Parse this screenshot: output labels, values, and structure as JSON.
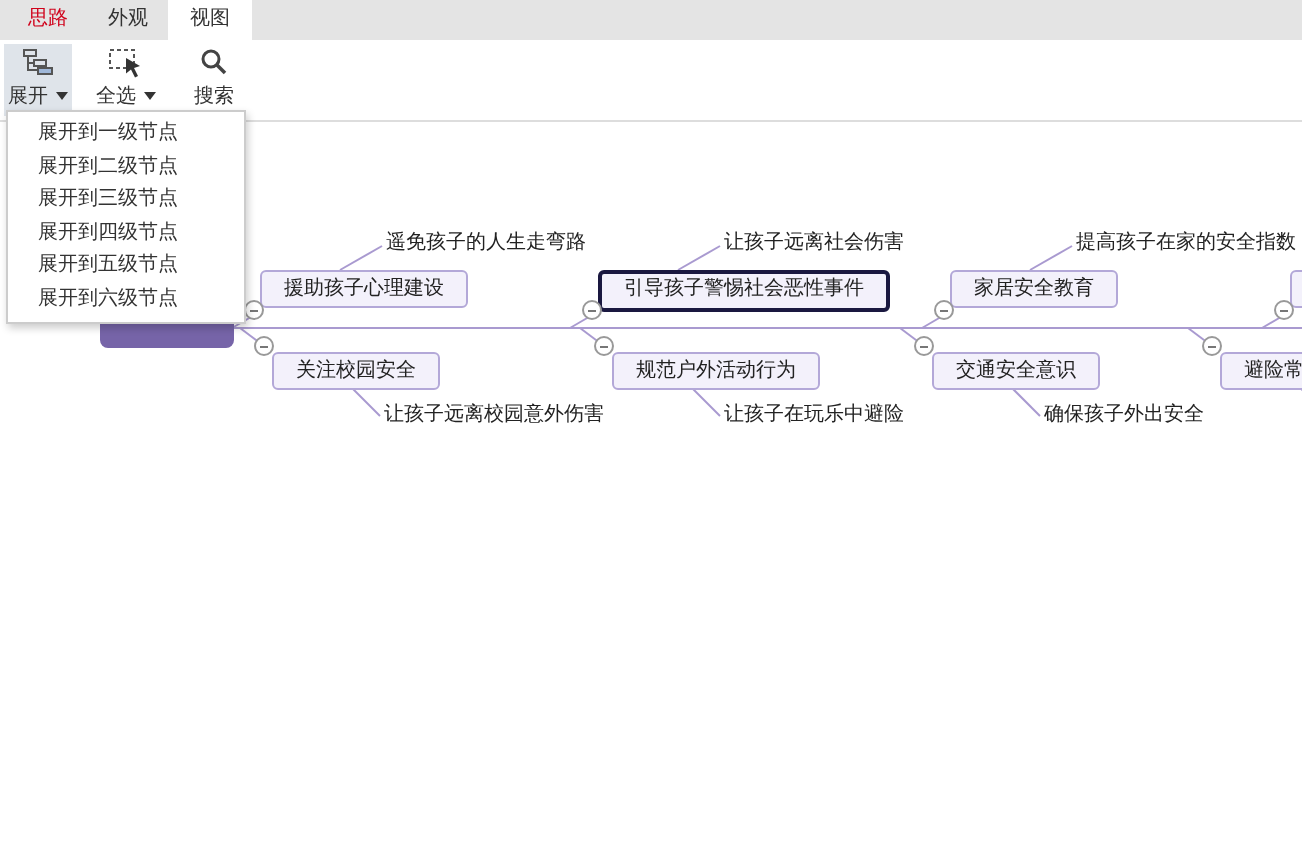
{
  "tabs": [
    {
      "label": "思路",
      "selected": false,
      "accent": true
    },
    {
      "label": "外观",
      "selected": false,
      "accent": false
    },
    {
      "label": "视图",
      "selected": true,
      "accent": false
    }
  ],
  "toolbar": [
    {
      "kind": "expand",
      "label": "展开",
      "dropdown": true,
      "selected": true
    },
    {
      "kind": "select",
      "label": "全选",
      "dropdown": true,
      "selected": false
    },
    {
      "kind": "search",
      "label": "搜索",
      "dropdown": false,
      "selected": false
    }
  ],
  "expand_menu": [
    "展开到一级节点",
    "展开到二级节点",
    "展开到三级节点",
    "展开到四级节点",
    "展开到五级节点",
    "展开到六级节点"
  ],
  "mindmap": {
    "upper_branches": [
      {
        "label": "援助孩子心理建设",
        "note": "遥免孩子的人生走弯路",
        "selected": false
      },
      {
        "label": "引导孩子警惕社会恶性事件",
        "note": "让孩子远离社会伤害",
        "selected": true
      },
      {
        "label": "家居安全教育",
        "note": "提高孩子在家的安全指数",
        "selected": false
      },
      {
        "selected": false
      }
    ],
    "lower_branches": [
      {
        "label": "关注校园安全",
        "note": "让孩子远离校园意外伤害",
        "selected": false
      },
      {
        "label": "规范户外活动行为",
        "note": "让孩子在玩乐中避险",
        "selected": false
      },
      {
        "label": "交通安全意识",
        "note": "确保孩子外出安全",
        "selected": false
      },
      {
        "label": "避险常",
        "selected": false
      }
    ]
  }
}
